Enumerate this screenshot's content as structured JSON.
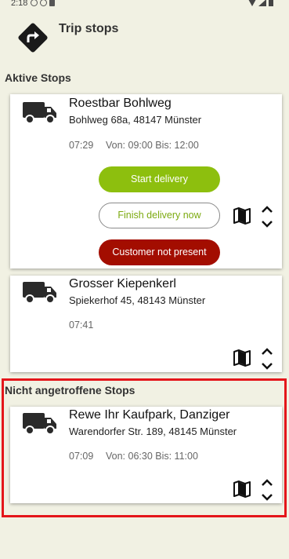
{
  "status_bar": {
    "time": "2:18"
  },
  "header": {
    "title": "Trip stops"
  },
  "sections": {
    "active": "Aktive Stops",
    "not_found": "Nicht angetroffene Stops"
  },
  "stops": [
    {
      "name": "Roestbar Bohlweg",
      "address": "Bohlweg 68a, 48147 Münster",
      "time": "07:29",
      "window": "Von: 09:00 Bis: 12:00"
    },
    {
      "name": "Grosser Kiepenkerl",
      "address": "Spiekerhof 45, 48143 Münster",
      "time": "07:41"
    },
    {
      "name": "Rewe Ihr Kaufpark, Danziger",
      "address": "Warendorfer Str. 189, 48145 Münster",
      "time": "07:09",
      "window": "Von: 06:30 Bis: 11:00"
    }
  ],
  "buttons": {
    "start": "Start delivery",
    "finish": "Finish delivery now",
    "absent": "Customer not present"
  },
  "colors": {
    "background": "#f1f1e3",
    "start_button": "#8dbf0e",
    "finish_text": "#7caa10",
    "absent_button": "#a30d00",
    "highlight": "#e4161b"
  },
  "icons": {
    "nav": "directions-icon",
    "stop": "truck-icon",
    "map": "map-icon",
    "reorder": "reorder-icon"
  }
}
